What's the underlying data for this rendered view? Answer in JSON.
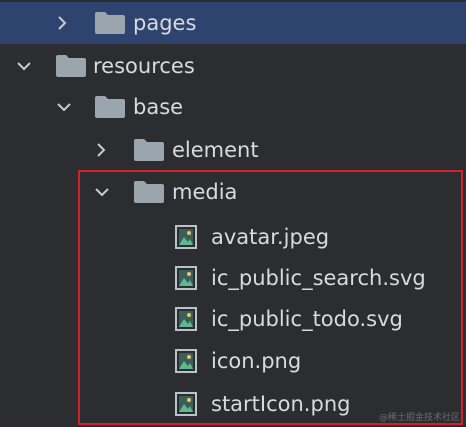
{
  "tree": {
    "pages": {
      "label": "pages",
      "state": "collapsed"
    },
    "resources": {
      "label": "resources",
      "state": "expanded"
    },
    "base": {
      "label": "base",
      "state": "expanded"
    },
    "element": {
      "label": "element",
      "state": "collapsed"
    },
    "media": {
      "label": "media",
      "state": "expanded",
      "files": [
        {
          "label": "avatar.jpeg"
        },
        {
          "label": "ic_public_search.svg"
        },
        {
          "label": "ic_public_todo.svg"
        },
        {
          "label": "icon.png"
        },
        {
          "label": "startIcon.png"
        }
      ]
    }
  },
  "watermark": "@稀土掘金技术社区",
  "colors": {
    "background": "#2b2d30",
    "selected_row": "#2e436e",
    "text": "#d7dade",
    "folder": "#9aa5ae",
    "highlight_border": "#d22128"
  },
  "icons": {
    "collapsed": "chevron-right-icon",
    "expanded": "chevron-down-icon",
    "folder": "folder-icon",
    "file": "image-file-icon"
  }
}
